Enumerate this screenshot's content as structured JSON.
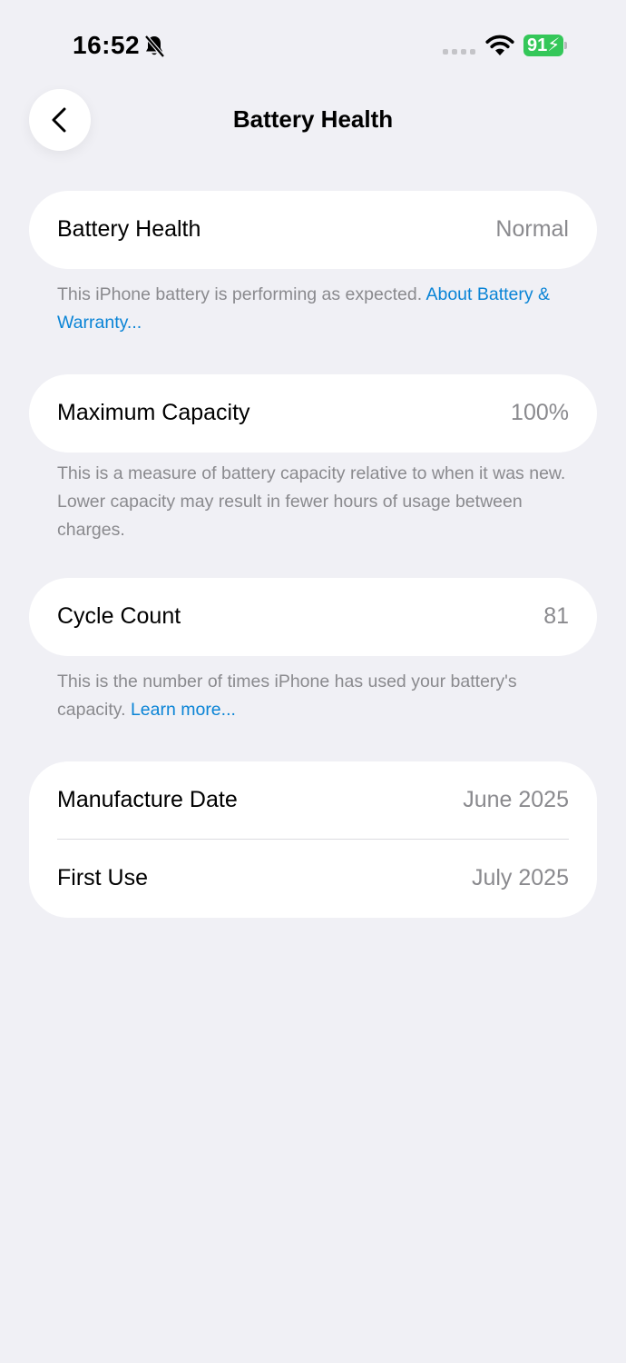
{
  "status_bar": {
    "time": "16:52",
    "battery_level": "91",
    "icons": {
      "mute": "bell-slash-icon",
      "signal": "cellular-signal-icon",
      "wifi": "wifi-icon",
      "battery": "battery-charging-icon"
    },
    "battery_color": "#34c759"
  },
  "nav": {
    "title": "Battery Health",
    "back_icon": "chevron-left-icon"
  },
  "battery_health": {
    "label": "Battery Health",
    "value": "Normal",
    "footnote": "This iPhone battery is performing as expected.",
    "link": "About Battery & Warranty..."
  },
  "maximum_capacity": {
    "label": "Maximum Capacity",
    "value": "100%",
    "footnote": "This is a measure of battery capacity relative to when it was new. Lower capacity may result in fewer hours of usage between charges."
  },
  "cycle_count": {
    "label": "Cycle Count",
    "value": "81",
    "footnote": "This is the number of times iPhone has used your battery's capacity.",
    "link": "Learn more..."
  },
  "dates": {
    "manufacture_label": "Manufacture Date",
    "manufacture_value": "June 2025",
    "first_use_label": "First Use",
    "first_use_value": "July 2025"
  },
  "colors": {
    "background": "#f0f0f5",
    "link": "#0a84d6",
    "secondary_text": "#8a8a8e"
  }
}
